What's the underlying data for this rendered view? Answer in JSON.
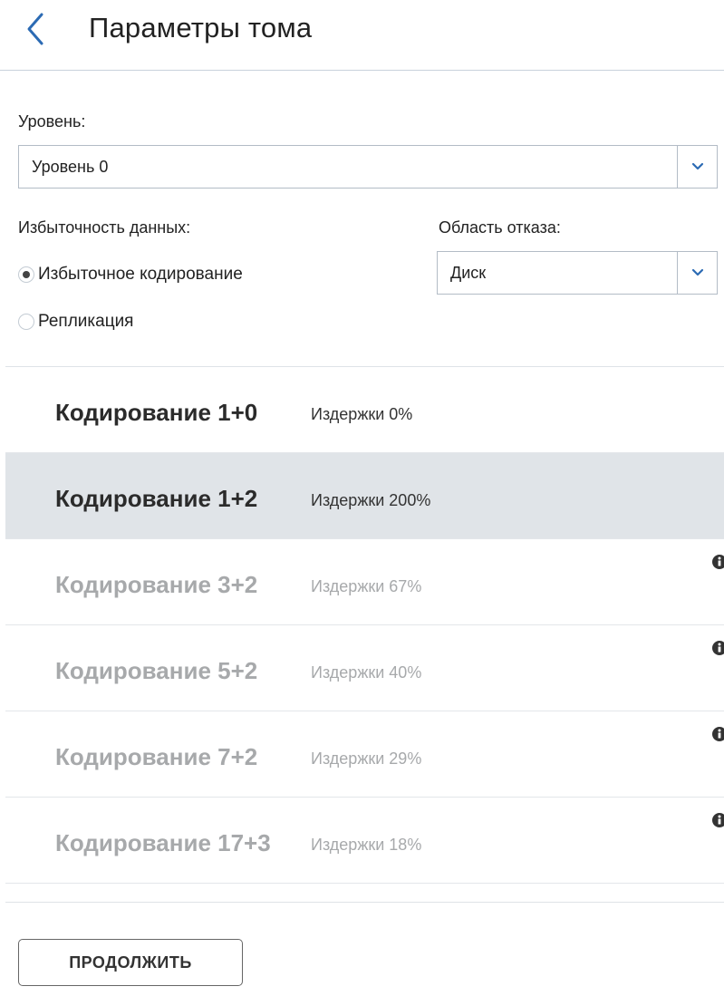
{
  "header": {
    "title": "Параметры тома",
    "back_icon": "chevron-left-icon",
    "accent_color": "#2c6bb4"
  },
  "level": {
    "label": "Уровень:",
    "selected": "Уровень 0"
  },
  "redundancy": {
    "label": "Избыточность данных:",
    "options": [
      {
        "label": "Избыточное кодирование",
        "checked": true
      },
      {
        "label": "Репликация",
        "checked": false
      }
    ]
  },
  "failure_domain": {
    "label": "Область отказа:",
    "selected": "Диск"
  },
  "encodings": [
    {
      "name": "Кодирование 1+0",
      "cost": "Издержки 0%",
      "enabled": true,
      "selected": false,
      "info": false
    },
    {
      "name": "Кодирование 1+2",
      "cost": "Издержки 200%",
      "enabled": true,
      "selected": true,
      "info": false
    },
    {
      "name": "Кодирование 3+2",
      "cost": "Издержки 67%",
      "enabled": false,
      "selected": false,
      "info": true
    },
    {
      "name": "Кодирование 5+2",
      "cost": "Издержки 40%",
      "enabled": false,
      "selected": false,
      "info": true
    },
    {
      "name": "Кодирование 7+2",
      "cost": "Издержки 29%",
      "enabled": false,
      "selected": false,
      "info": true
    },
    {
      "name": "Кодирование 17+3",
      "cost": "Издержки 18%",
      "enabled": false,
      "selected": false,
      "info": true
    }
  ],
  "actions": {
    "continue_label": "ПРОДОЛЖИТЬ"
  },
  "colors": {
    "selected_row_bg": "#e0e4e8",
    "disabled_text": "#a7a9ab"
  }
}
